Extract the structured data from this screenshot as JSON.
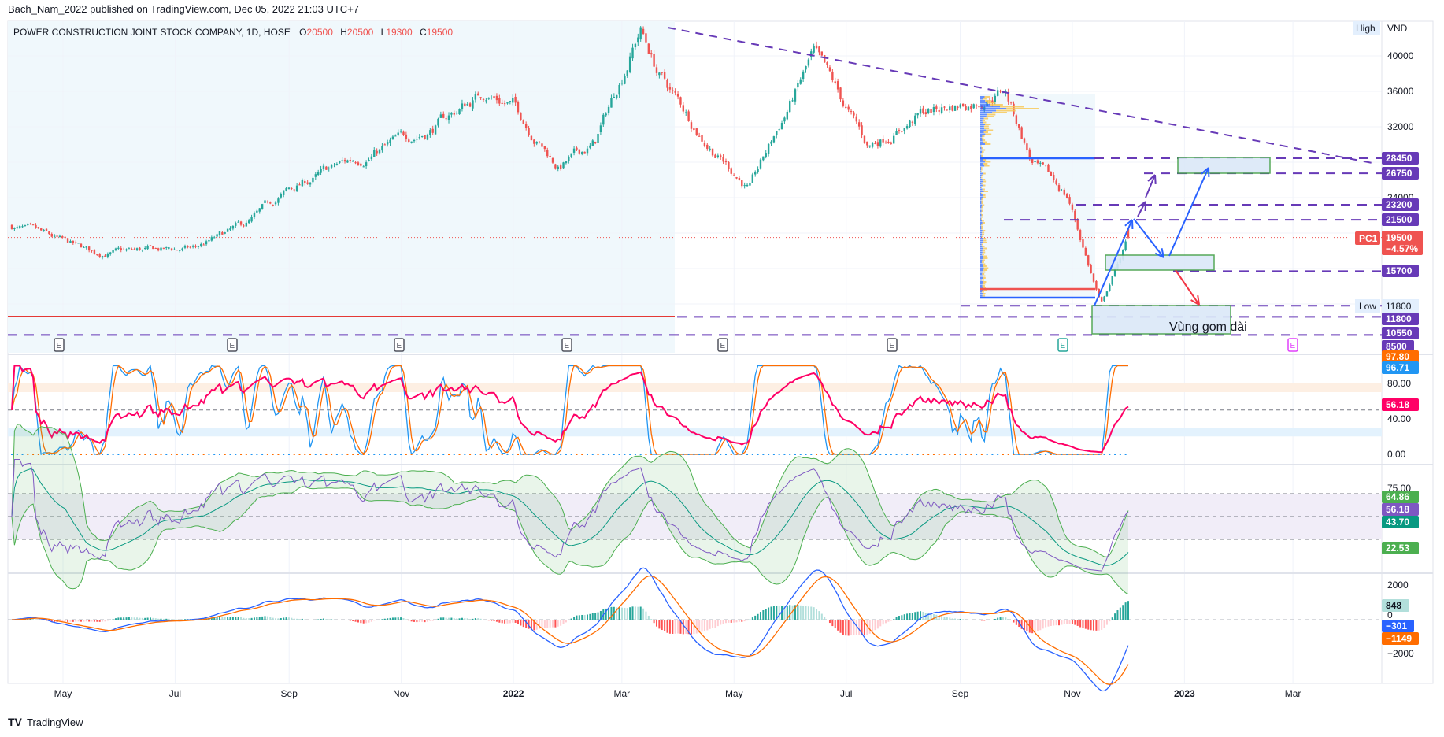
{
  "publish_line": "Bach_Nam_2022 published on TradingView.com, Dec 05, 2022 21:03 UTC+7",
  "legend": {
    "title": "POWER CONSTRUCTION JOINT STOCK COMPANY, 1D, HOSE",
    "o_label": "O",
    "o": "20500",
    "h_label": "H",
    "h": "20500",
    "l_label": "L",
    "l": "19300",
    "c_label": "C",
    "c": "19500"
  },
  "footer_brand": "TradingView",
  "annotation_text": "Vùng gom dài",
  "high_marker": "High",
  "low_marker": "Low",
  "currency": "VND",
  "symbol_tag": "PC1",
  "earnings_marker": "E",
  "colors": {
    "up": "#26a69a",
    "down": "#ef5350",
    "level": "#673ab7",
    "trend": "#2962ff",
    "stoch_k": "#2196f3",
    "stoch_d": "#ff6d00",
    "rsi_main": "#ff0066",
    "rsi": "#7e57c2",
    "bb": "#4caf50",
    "macd": "#2962ff",
    "signal": "#ff6d00"
  },
  "chart_data": {
    "type": "candlestick",
    "title": "POWER CONSTRUCTION JOINT STOCK COMPANY, 1D, HOSE",
    "ylabel": "VND",
    "ylim": [
      8000,
      43500
    ],
    "price_ticks": [
      "40000",
      "36000",
      "32000",
      "24000"
    ],
    "x_ticks": [
      "May",
      "Jul",
      "Sep",
      "Nov",
      "2022",
      "Mar",
      "May",
      "Jul",
      "Sep",
      "Nov",
      "2023",
      "Mar"
    ],
    "waypoints_day_price": [
      [
        0,
        20800
      ],
      [
        45,
        17700
      ],
      [
        100,
        18200
      ],
      [
        130,
        21000
      ],
      [
        150,
        24500
      ],
      [
        180,
        27600
      ],
      [
        230,
        31800
      ],
      [
        260,
        36000
      ],
      [
        275,
        34500
      ],
      [
        300,
        27500
      ],
      [
        320,
        30000
      ],
      [
        345,
        43200
      ],
      [
        355,
        38000
      ],
      [
        380,
        30700
      ],
      [
        405,
        25000
      ],
      [
        440,
        40000
      ],
      [
        470,
        29700
      ],
      [
        500,
        33500
      ],
      [
        530,
        35000
      ],
      [
        545,
        36500
      ],
      [
        560,
        28000
      ],
      [
        580,
        24000
      ],
      [
        598,
        11800
      ],
      [
        613,
        19500
      ]
    ],
    "last": {
      "open": 20500,
      "high": 20500,
      "low": 19300,
      "close": 19500,
      "change_pct": "−4.57%"
    },
    "period_high": 43200,
    "period_low": "11800",
    "levels": [
      {
        "value": 28450,
        "label": "28450"
      },
      {
        "value": 26750,
        "label": "26750"
      },
      {
        "value": 23200,
        "label": "23200"
      },
      {
        "value": 21500,
        "label": "21500"
      },
      {
        "value": 15700,
        "label": "15700"
      },
      {
        "value": 11800,
        "label": "11800"
      },
      {
        "value": 10550,
        "label": "10550"
      },
      {
        "value": 8500,
        "label": "8500"
      }
    ],
    "last_price_label": "19500",
    "stoch_rsi": {
      "ticks": [
        "80.00",
        "40.00",
        "0.00"
      ],
      "k": "96.71",
      "d": "97.80",
      "rsi": "56.18",
      "bands": [
        [
          70,
          80
        ],
        [
          20,
          30
        ]
      ],
      "mid": 50
    },
    "rsi": {
      "ticks": [
        "75.00"
      ],
      "rsi": "56.18",
      "bb_upper": "64.86",
      "bb_basis": "43.70",
      "bb_lower": "22.53",
      "levels": [
        70,
        50,
        30
      ]
    },
    "macd": {
      "ticks": [
        "2000",
        "0",
        "−2000"
      ],
      "hist": "848",
      "macd": "−301",
      "signal": "−1149"
    }
  }
}
